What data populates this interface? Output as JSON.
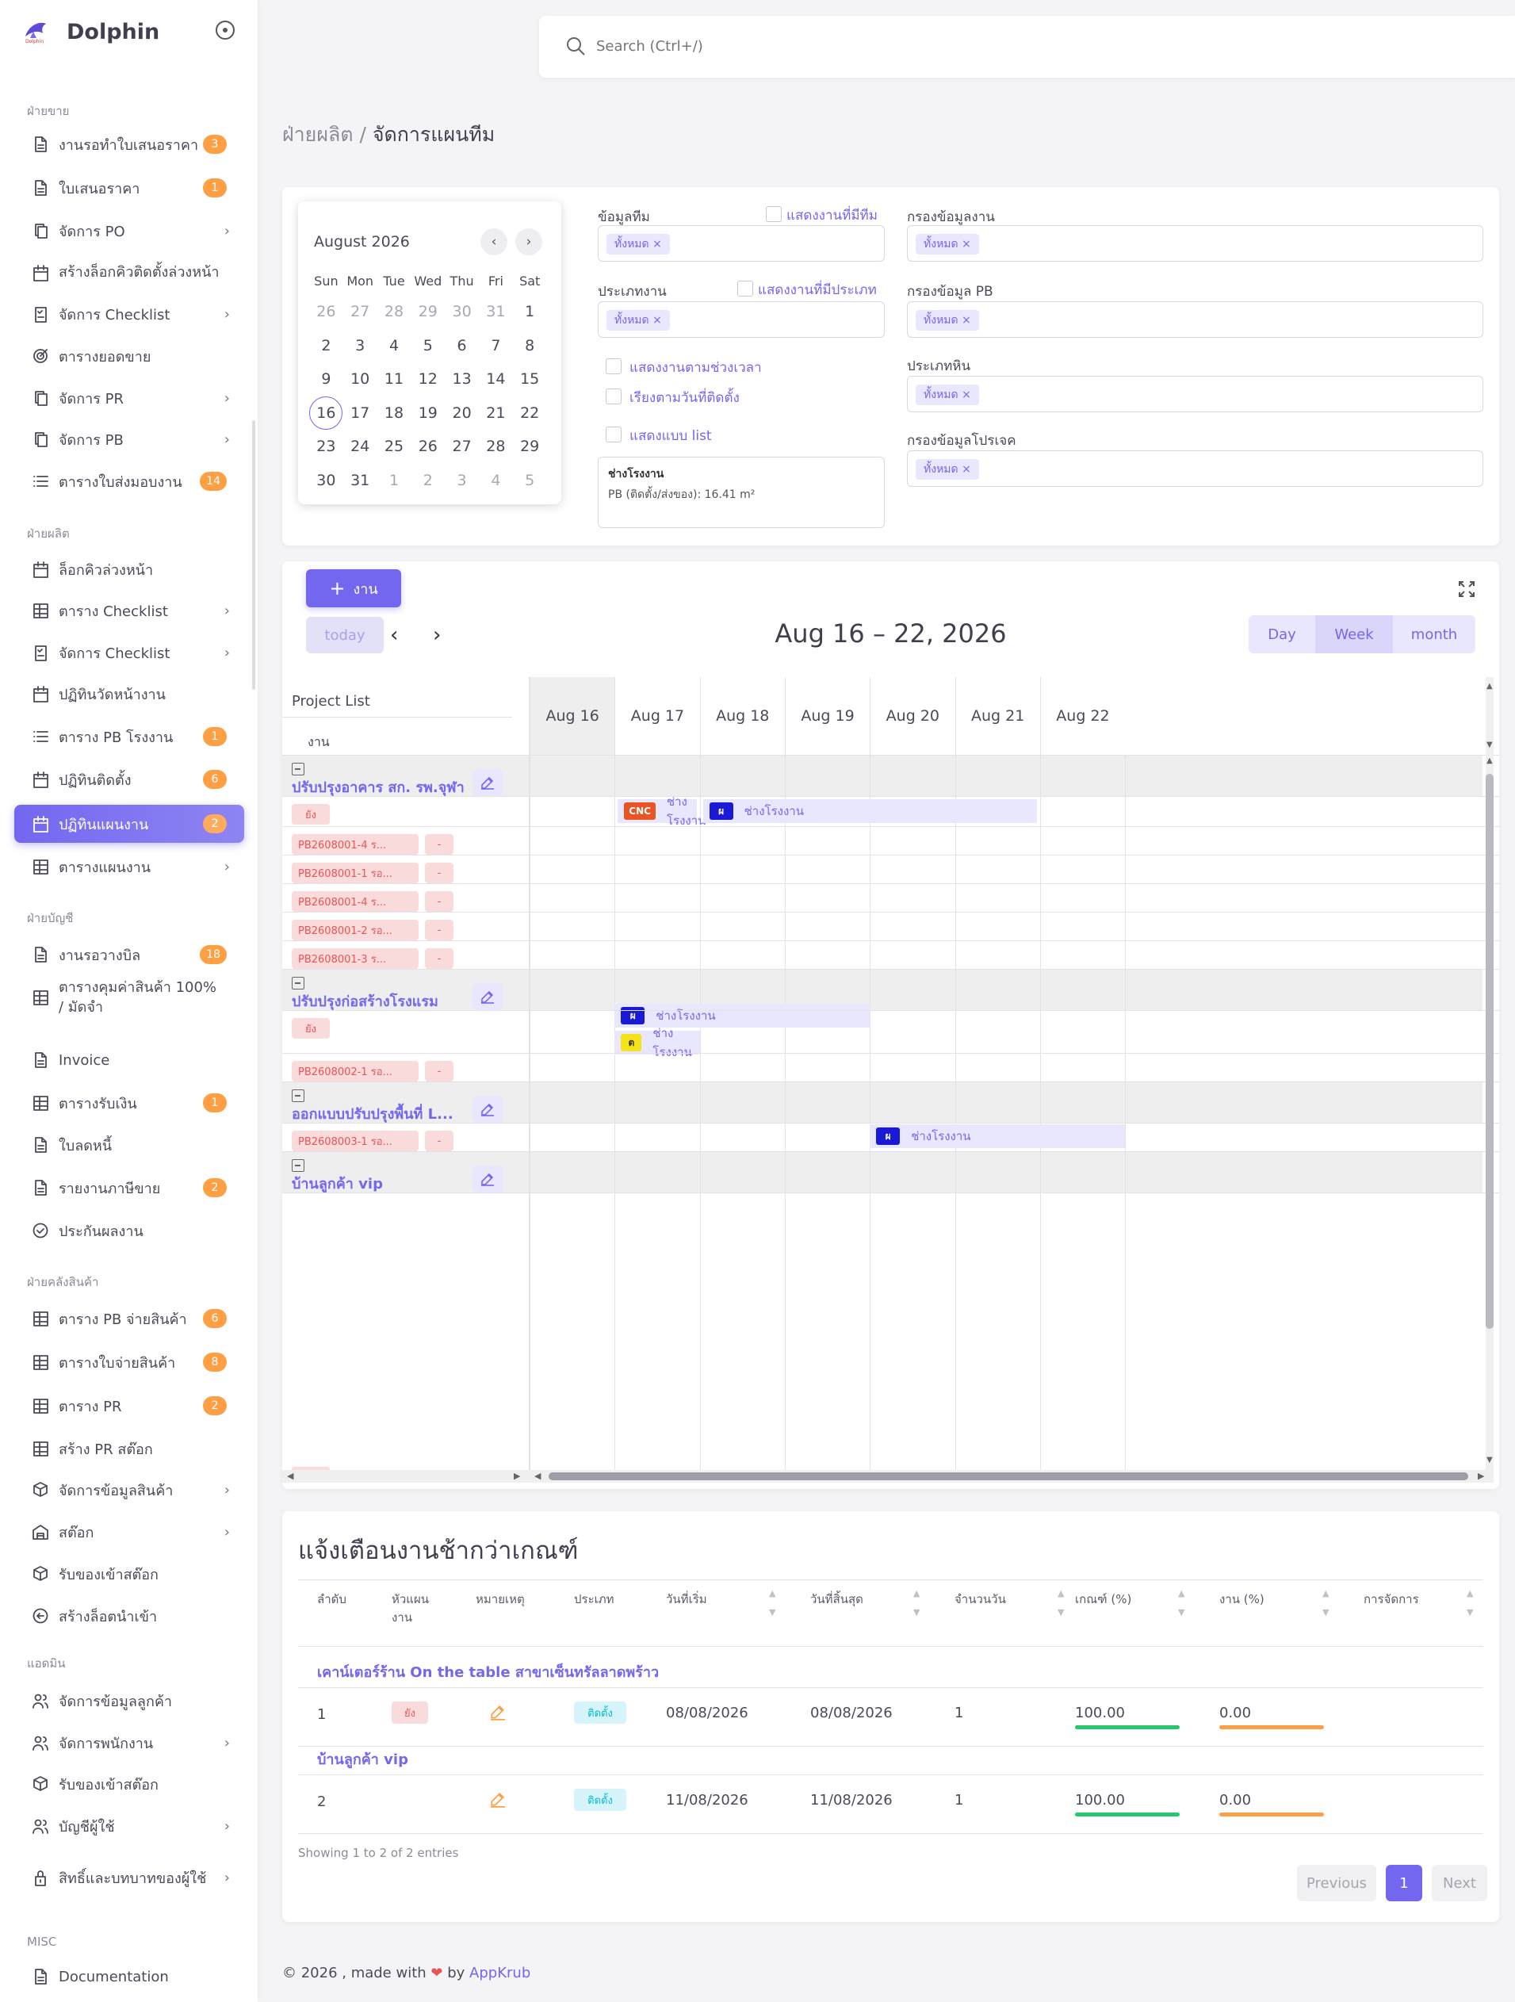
{
  "app": {
    "name": "Dolphin",
    "logo_caption": "Dolphin"
  },
  "search": {
    "placeholder": "Search (Ctrl+/)"
  },
  "breadcrumb": {
    "parent": "ฝ่ายผลิต /",
    "current": "จัดการแผนทีม"
  },
  "sidebar": {
    "sections": [
      {
        "title": "ฝ่ายขาย",
        "items": [
          {
            "label": "งานรอทำใบเสนอราคา",
            "icon": "document-icon",
            "badge": "3"
          },
          {
            "label": "ใบเสนอราคา",
            "icon": "document-icon",
            "badge": "1"
          },
          {
            "label": "จัดการ PO",
            "icon": "copy-icon",
            "chevron": true
          },
          {
            "label": "สร้างล็อกคิวติดตั้งล่วงหน้า",
            "icon": "calendar-icon"
          },
          {
            "label": "จัดการ Checklist",
            "icon": "checklist-icon",
            "chevron": true
          },
          {
            "label": "ตารางยอดขาย",
            "icon": "target-icon"
          },
          {
            "label": "จัดการ PR",
            "icon": "copy-icon",
            "chevron": true
          },
          {
            "label": "จัดการ PB",
            "icon": "copy-icon",
            "chevron": true
          },
          {
            "label": "ตารางใบส่งมอบงาน",
            "icon": "list-icon",
            "badge": "14"
          }
        ]
      },
      {
        "title": "ฝ่ายผลิต",
        "items": [
          {
            "label": "ล็อกคิวล่วงหน้า",
            "icon": "calendar-icon"
          },
          {
            "label": "ตาราง Checklist",
            "icon": "table-icon",
            "chevron": true
          },
          {
            "label": "จัดการ Checklist",
            "icon": "checklist-icon",
            "chevron": true
          },
          {
            "label": "ปฏิทินวัดหน้างาน",
            "icon": "calendar-icon"
          },
          {
            "label": "ตาราง PB โรงงาน",
            "icon": "list-icon",
            "badge": "1"
          },
          {
            "label": "ปฏิทินติดตั้ง",
            "icon": "calendar-icon",
            "badge": "6"
          },
          {
            "label": "ปฏิทินแผนงาน",
            "icon": "calendar-icon",
            "badge": "2",
            "active": true
          },
          {
            "label": "ตารางแผนงาน",
            "icon": "table-icon",
            "chevron": true
          }
        ]
      },
      {
        "title": "ฝ่ายบัญชี",
        "items": [
          {
            "label": "งานรอวางบิล",
            "icon": "document-icon",
            "badge": "18"
          },
          {
            "label": "ตารางคุมค่าสินค้า 100% / มัดจำ",
            "icon": "table-icon"
          },
          {
            "label": "Invoice",
            "icon": "document-icon"
          },
          {
            "label": "ตารางรับเงิน",
            "icon": "table-icon",
            "badge": "1"
          },
          {
            "label": "ใบลดหนี้",
            "icon": "document-icon"
          },
          {
            "label": "รายงานภาษีขาย",
            "icon": "document-icon",
            "badge": "2"
          },
          {
            "label": "ประกันผลงาน",
            "icon": "check-circle-icon"
          }
        ]
      },
      {
        "title": "ฝ่ายคลังสินค้า",
        "items": [
          {
            "label": "ตาราง PB จ่ายสินค้า",
            "icon": "table-icon",
            "badge": "6"
          },
          {
            "label": "ตารางใบจ่ายสินค้า",
            "icon": "table-icon",
            "badge": "8"
          },
          {
            "label": "ตาราง PR",
            "icon": "table-icon",
            "badge": "2"
          },
          {
            "label": "สร้าง PR สต๊อก",
            "icon": "table-icon"
          },
          {
            "label": "จัดการข้อมูลสินค้า",
            "icon": "box-icon",
            "chevron": true
          },
          {
            "label": "สต๊อก",
            "icon": "warehouse-icon",
            "chevron": true
          },
          {
            "label": "รับของเข้าสต๊อก",
            "icon": "box-icon"
          },
          {
            "label": "สร้างล็อตนำเข้า",
            "icon": "arrow-circle-icon"
          }
        ]
      },
      {
        "title": "แอดมิน",
        "items": [
          {
            "label": "จัดการข้อมูลลูกค้า",
            "icon": "users-icon"
          },
          {
            "label": "จัดการพนักงาน",
            "icon": "users-icon",
            "chevron": true
          },
          {
            "label": "รับของเข้าสต๊อก",
            "icon": "box-icon"
          },
          {
            "label": "บัญชีผู้ใช้",
            "icon": "users-icon",
            "chevron": true
          },
          {
            "label": "สิทธิ์และบทบาทของผู้ใช้",
            "icon": "lock-icon",
            "chevron": true
          }
        ]
      },
      {
        "title": "MISC",
        "items": [
          {
            "label": "Documentation",
            "icon": "document-icon"
          }
        ]
      }
    ]
  },
  "mini_calendar": {
    "title": "August 2026",
    "weekdays": [
      "Sun",
      "Mon",
      "Tue",
      "Wed",
      "Thu",
      "Fri",
      "Sat"
    ],
    "weeks": [
      [
        "26",
        "27",
        "28",
        "29",
        "30",
        "31",
        "1"
      ],
      [
        "2",
        "3",
        "4",
        "5",
        "6",
        "7",
        "8"
      ],
      [
        "9",
        "10",
        "11",
        "12",
        "13",
        "14",
        "15"
      ],
      [
        "16",
        "17",
        "18",
        "19",
        "20",
        "21",
        "22"
      ],
      [
        "23",
        "24",
        "25",
        "26",
        "27",
        "28",
        "29"
      ],
      [
        "30",
        "31",
        "1",
        "2",
        "3",
        "4",
        "5"
      ]
    ],
    "selected": "16"
  },
  "filters": {
    "team": {
      "label": "ข้อมูลทีม",
      "check_label": "แสดงงานที่มีทีม",
      "value": "ทั้งหมด ×"
    },
    "job_type": {
      "label": "ประเภทงาน",
      "check_label": "แสดงงานที่มีประเภท",
      "value": "ทั้งหมด ×"
    },
    "show_by_time": "แสดงงานตามช่วงเวลา",
    "sort_by_install": "เรียงตามวันที่ติดตั้ง",
    "show_list": "แสดงแบบ list",
    "note_title": "ช่างโรงงาน",
    "note_text": "PB (ติดตั้ง/ส่งของ): 16.41 m²",
    "job_filter": {
      "label": "กรองข้อมูลงาน",
      "value": "ทั้งหมด ×"
    },
    "pb_filter": {
      "label": "กรองข้อมูล PB",
      "value": "ทั้งหมด ×"
    },
    "stone_type": {
      "label": "ประเภทหิน",
      "value": "ทั้งหมด ×"
    },
    "project_filter": {
      "label": "กรองข้อมูลโปรเจค",
      "value": "ทั้งหมด ×"
    }
  },
  "scheduler": {
    "add_label": "งาน",
    "today_label": "today",
    "title": "Aug 16 – 22, 2026",
    "views": [
      "Day",
      "Week",
      "month"
    ],
    "active_view": "Week",
    "left_header": "Project List",
    "left_subheader": "งาน",
    "days": [
      "Aug 16",
      "Aug 17",
      "Aug 18",
      "Aug 19",
      "Aug 20",
      "Aug 21",
      "Aug 22"
    ],
    "groups": [
      {
        "title": "ปรับปรุงอาคาร สก. รพ.จุฬา",
        "rows": [
          "ยัง",
          "PB2608001-4 ร...",
          "PB2608001-1 รอ...",
          "PB2608001-4 ร...",
          "PB2608001-2 รอ...",
          "PB2608001-3 ร..."
        ],
        "dash": "-"
      },
      {
        "title": "ปรับปรุงก่อสร้างโรงแรม",
        "rows": [
          "ยัง",
          "PB2608002-1 รอ..."
        ],
        "dash": "-"
      },
      {
        "title": "ออกแบบปรับปรุงพื้นที่ L...",
        "rows": [
          "PB2608003-1 รอ..."
        ],
        "dash": "-"
      },
      {
        "title": "บ้านลูกค้า vip",
        "rows": []
      }
    ],
    "events": [
      {
        "badge": "CNC",
        "color": "#ea5422",
        "text": "ช่างโรงงาน"
      },
      {
        "badge": "ผ",
        "color": "#1a1ad6",
        "text": "ช่างโรงงาน"
      },
      {
        "badge": "ผ",
        "color": "#1a1ad6",
        "text": "ช่างโรงงาน"
      },
      {
        "badge": "ต",
        "color": "#f5e31a",
        "text": "ช่างโรงงาน"
      },
      {
        "badge": "ผ",
        "color": "#1a1ad6",
        "text": "ช่างโรงงาน"
      }
    ]
  },
  "alert_table": {
    "title": "แจ้งเตือนงานช้ากว่าเกณฑ์",
    "headers": [
      "ลำดับ",
      "หัวแผน งาน",
      "หมายเหตุ",
      "ประเภท",
      "วันที่เริ่ม",
      "วันที่สิ้นสุด",
      "จำนวนวัน",
      "เกณฑ์ (%)",
      "งาน (%)",
      "การจัดการ"
    ],
    "groups": [
      {
        "title": "เคาน์เตอร์ร้าน On the table สาขาเซ็นทรัลลาดพร้าว",
        "row": {
          "no": "1",
          "status": "ยัง",
          "type": "ติดตั้ง",
          "start": "08/08/2026",
          "end": "08/08/2026",
          "days": "1",
          "criteria": "100.00",
          "work": "0.00",
          "criteria_pct": 100,
          "work_pct": 0
        }
      },
      {
        "title": "บ้านลูกค้า vip",
        "row": {
          "no": "2",
          "status": "",
          "type": "ติดตั้ง",
          "start": "11/08/2026",
          "end": "11/08/2026",
          "days": "1",
          "criteria": "100.00",
          "work": "0.00",
          "criteria_pct": 100,
          "work_pct": 0
        }
      }
    ],
    "showing": "Showing 1 to 2 of 2 entries",
    "prev": "Previous",
    "page": "1",
    "next": "Next"
  },
  "footer": {
    "copy": "© 2026 , made with",
    "by": "by",
    "link": "AppKrub"
  },
  "colors": {
    "primary": "#7367f0",
    "warning": "#ff9f43",
    "danger": "#ea5455",
    "success": "#28c76f",
    "info": "#00bad1"
  }
}
